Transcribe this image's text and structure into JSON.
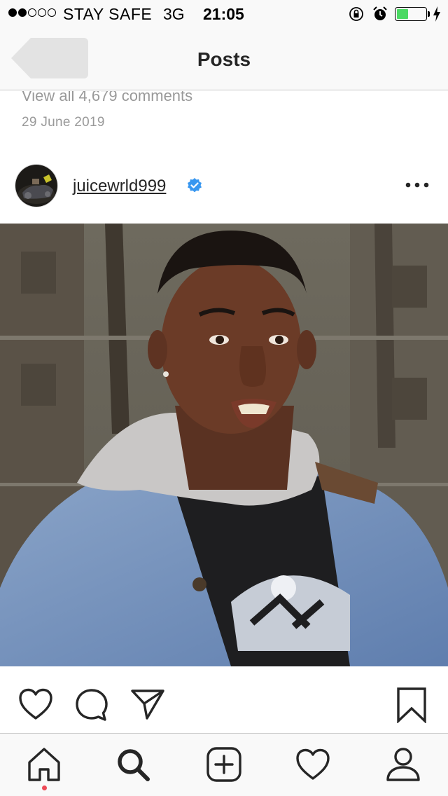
{
  "status_bar": {
    "carrier": "STAY SAFE",
    "network": "3G",
    "time": "21:05",
    "signal_strength": 2,
    "signal_max": 5,
    "battery_level": 0.4,
    "battery_color": "#4cd964",
    "icons": [
      "rotation-lock-icon",
      "alarm-icon",
      "battery-icon",
      "charging-icon"
    ]
  },
  "nav": {
    "back_icon": "chevron-left-icon",
    "title": "Posts"
  },
  "previous_post": {
    "comments_link": "View all 4,679 comments",
    "date": "29 June 2019"
  },
  "post": {
    "username": "juicewrld999",
    "verified": true,
    "verified_color": "#3897f0",
    "more_icon": "ellipsis-icon",
    "actions": {
      "like_icon": "heart-icon",
      "comment_icon": "comment-icon",
      "share_icon": "paper-plane-icon",
      "save_icon": "bookmark-icon"
    }
  },
  "tab_bar": {
    "tabs": [
      "home-icon",
      "search-icon",
      "add-icon",
      "heart-icon",
      "profile-icon"
    ],
    "active_tab": "home",
    "notification_dot_color": "#ed4956"
  }
}
